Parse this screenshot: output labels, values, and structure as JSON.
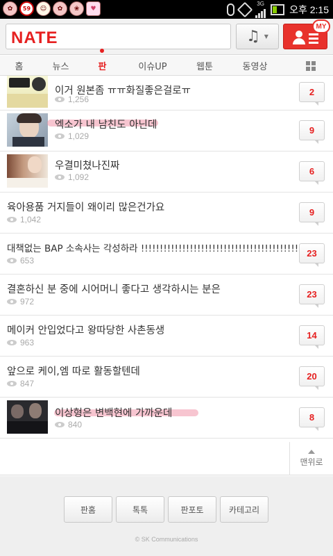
{
  "status_bar": {
    "notification_icons": [
      "flower-icon",
      "badge-icon",
      "character-icon",
      "flower-icon",
      "flower-icon",
      "heart-icon"
    ],
    "badge_text": "59",
    "network": "3G",
    "time": "오후 2:15"
  },
  "header": {
    "logo": "NATE",
    "search_placeholder": "",
    "music_button_icon": "music-note-icon",
    "my_button_icon": "profile-menu-icon",
    "my_badge": "MY"
  },
  "tabs": [
    {
      "label": "홈"
    },
    {
      "label": "뉴스"
    },
    {
      "label": "판",
      "active": true
    },
    {
      "label": "이슈UP"
    },
    {
      "label": "웹툰"
    },
    {
      "label": "동영상"
    }
  ],
  "posts": [
    {
      "title": "이거 원본좀 ㅠㅠ화질좋은걸로ㅠ",
      "views": "1,256",
      "comments": "2",
      "thumb": "comic"
    },
    {
      "title": "엑소가 내 남친도 아닌데",
      "views": "1,029",
      "comments": "9",
      "thumb": "portrait",
      "highlight": true
    },
    {
      "title": "우결미쳤나진짜",
      "views": "1,092",
      "comments": "6",
      "thumb": "tv"
    },
    {
      "title": "육아용품 거지들이 왜이리 많은건가요",
      "views": "1,042",
      "comments": "9",
      "thumb": ""
    },
    {
      "title": "대책없는 BAP 소속사는 각성하라 !!!!!!!!!!!!!!!!!!!!!!!!!!!!!!!!!!!!!!!!!!!!!!",
      "views": "653",
      "comments": "23",
      "thumb": ""
    },
    {
      "title": "결혼하신 분 중에 시어머니 좋다고 생각하시는 분은",
      "views": "972",
      "comments": "23",
      "thumb": ""
    },
    {
      "title": "메이커 안입었다고 왕따당한 사촌동생",
      "views": "963",
      "comments": "14",
      "thumb": ""
    },
    {
      "title": "앞으로 케이,엠 따로 활동할텐데",
      "views": "847",
      "comments": "20",
      "thumb": ""
    },
    {
      "title": "이상형은 변백현에 가까운데",
      "views": "840",
      "comments": "8",
      "thumb": "dark",
      "highlight": true
    }
  ],
  "back_to_top": "맨위로",
  "footer": {
    "buttons": [
      "판홈",
      "톡톡",
      "판포토",
      "카테고리"
    ],
    "copyright": "© SK Communications"
  },
  "colors": {
    "accent": "#e62020",
    "highlight": "#f096aa"
  }
}
